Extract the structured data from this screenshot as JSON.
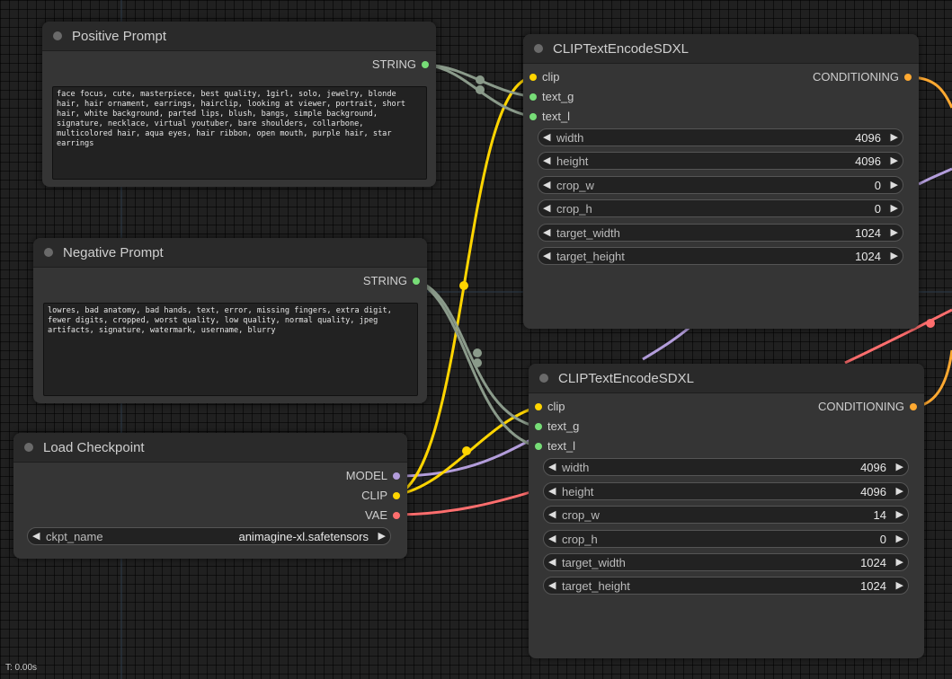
{
  "colors": {
    "clip": "#ffd500",
    "model": "#b39ddb",
    "vae": "#ff6e6e",
    "conditioning": "#ffa931",
    "string": "#77dd77",
    "string_link": "#8a9a8a"
  },
  "positive": {
    "title": "Positive Prompt",
    "output": "STRING",
    "text": "face focus, cute, masterpiece, best quality, 1girl, solo, jewelry, blonde hair, hair ornament, earrings, hairclip, looking at viewer, portrait, short hair, white background, parted lips, blush, bangs, simple background, signature, necklace, virtual youtuber, bare shoulders, collarbone, multicolored hair, aqua eyes, hair ribbon, open mouth, purple hair, star earrings"
  },
  "negative": {
    "title": "Negative Prompt",
    "output": "STRING",
    "text": "lowres, bad anatomy, bad hands, text, error, missing fingers, extra digit, fewer digits, cropped, worst quality, low quality, normal quality, jpeg artifacts, signature, watermark, username, blurry"
  },
  "checkpoint": {
    "title": "Load Checkpoint",
    "outputs": [
      "MODEL",
      "CLIP",
      "VAE"
    ],
    "ckpt_label": "ckpt_name",
    "ckpt_value": "animagine-xl.safetensors"
  },
  "encode1": {
    "title": "CLIPTextEncodeSDXL",
    "inputs": [
      "clip",
      "text_g",
      "text_l"
    ],
    "output": "CONDITIONING",
    "widgets": [
      {
        "name": "width",
        "value": "4096"
      },
      {
        "name": "height",
        "value": "4096"
      },
      {
        "name": "crop_w",
        "value": "0"
      },
      {
        "name": "crop_h",
        "value": "0"
      },
      {
        "name": "target_width",
        "value": "1024"
      },
      {
        "name": "target_height",
        "value": "1024"
      }
    ]
  },
  "encode2": {
    "title": "CLIPTextEncodeSDXL",
    "inputs": [
      "clip",
      "text_g",
      "text_l"
    ],
    "output": "CONDITIONING",
    "widgets": [
      {
        "name": "width",
        "value": "4096"
      },
      {
        "name": "height",
        "value": "4096"
      },
      {
        "name": "crop_w",
        "value": "14"
      },
      {
        "name": "crop_h",
        "value": "0"
      },
      {
        "name": "target_width",
        "value": "1024"
      },
      {
        "name": "target_height",
        "value": "1024"
      }
    ]
  },
  "status": {
    "time": "T: 0.00s"
  },
  "icons": {
    "left_arrow": "◀",
    "right_arrow": "▶"
  }
}
